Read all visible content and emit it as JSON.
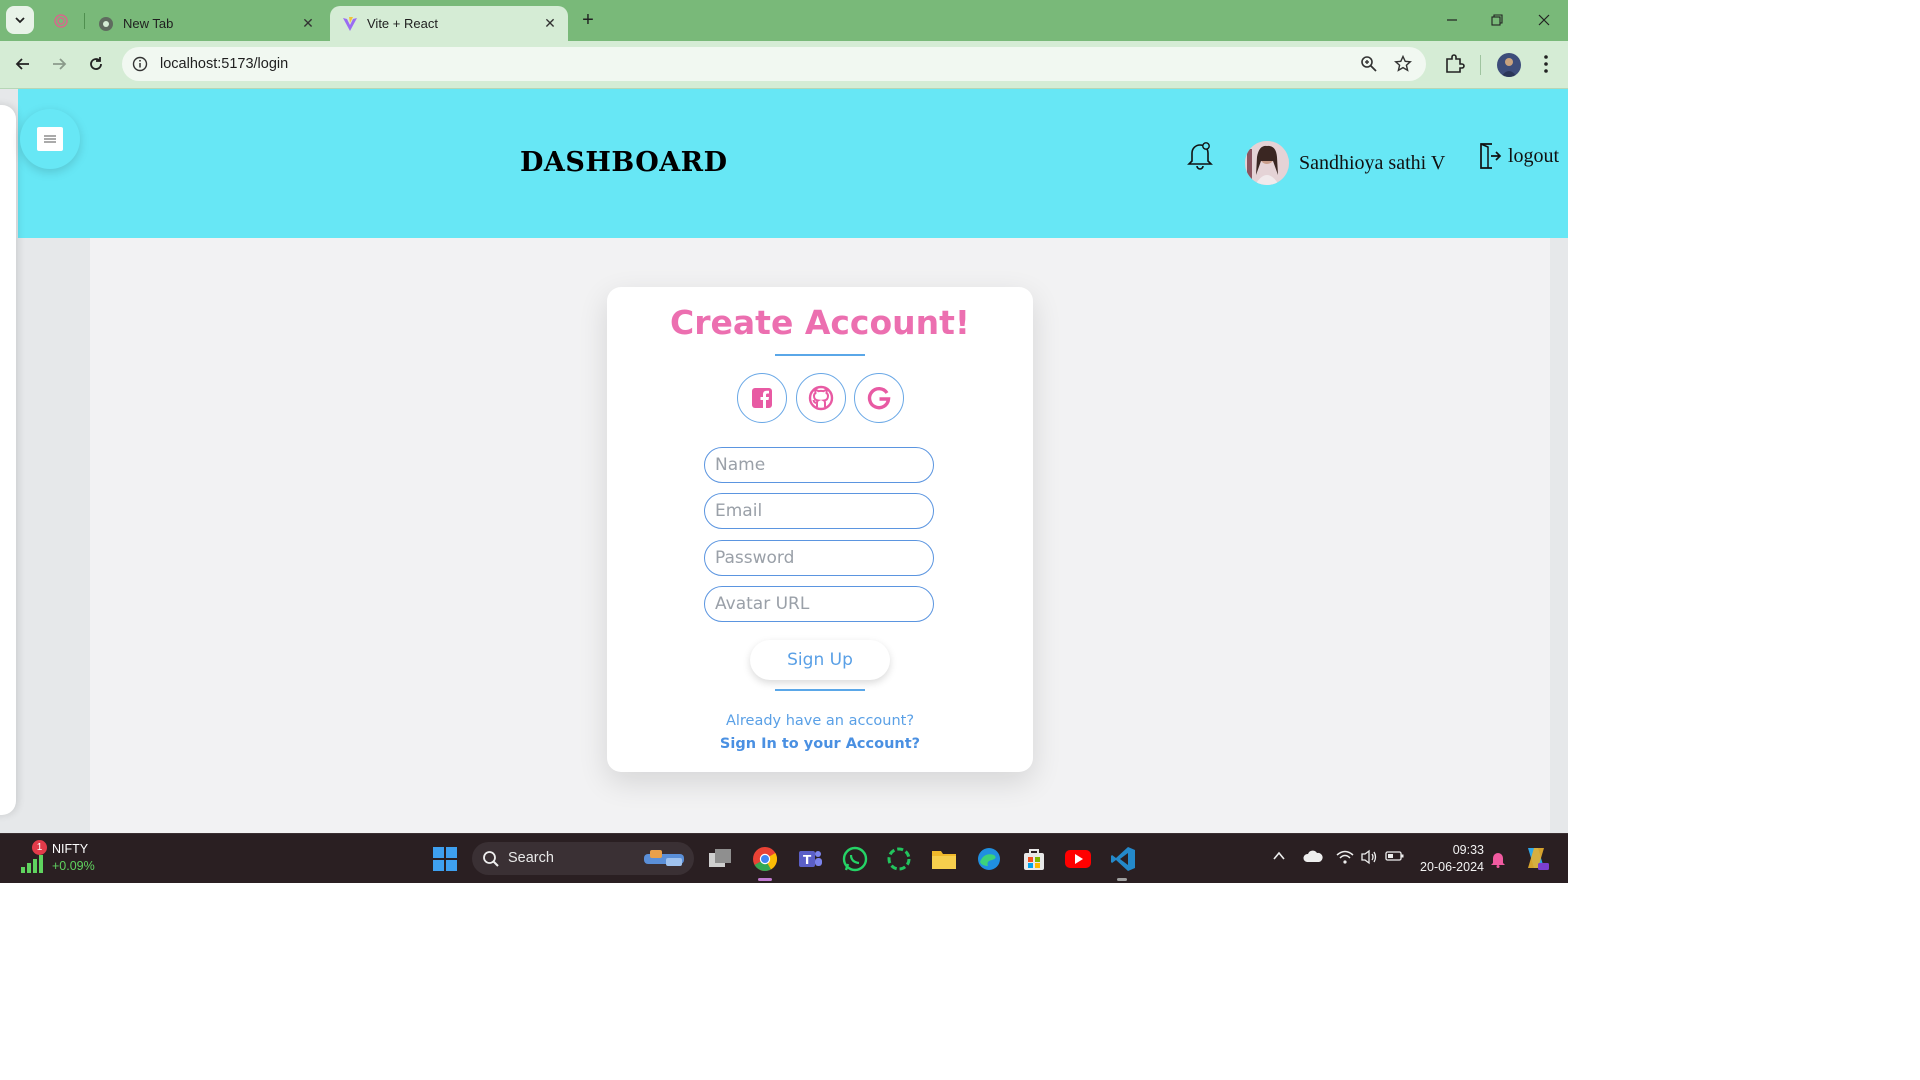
{
  "browser": {
    "tabs": [
      {
        "title": "New Tab",
        "active": false
      },
      {
        "title": "Vite + React",
        "active": true
      }
    ],
    "url": "localhost:5173/login"
  },
  "header": {
    "title": "DASHBOARD",
    "user_name": "Sandhioya sathi V",
    "logout_label": "logout"
  },
  "signup_card": {
    "title": "Create Account!",
    "social": [
      "facebook-icon",
      "github-icon",
      "google-icon"
    ],
    "fields": {
      "name_placeholder": "Name",
      "email_placeholder": "Email",
      "password_placeholder": "Password",
      "avatar_placeholder": "Avatar URL"
    },
    "submit_label": "Sign Up",
    "already_text": "Already have an account?",
    "signin_link": "Sign In to your Account?"
  },
  "taskbar": {
    "ticker_name": "NIFTY",
    "ticker_change": "+0.09%",
    "ticker_badge": "1",
    "search_label": "Search",
    "time": "09:33",
    "date": "20-06-2024"
  },
  "colors": {
    "header_bg": "#67e7f5",
    "title_pink": "#ec6fb0",
    "accent_blue": "#5aa0e6"
  }
}
